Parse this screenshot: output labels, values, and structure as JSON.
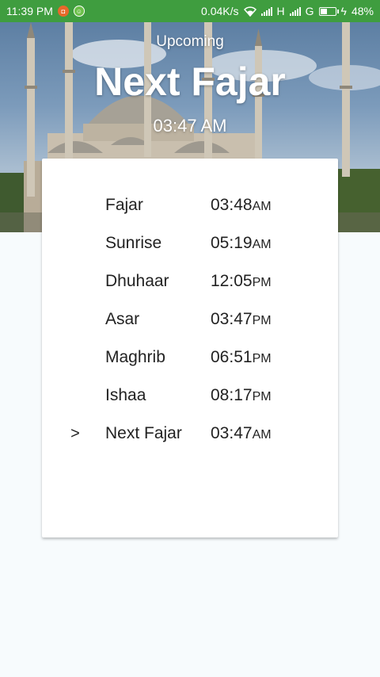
{
  "status_bar": {
    "time": "11:39 PM",
    "net_speed": "0.04K/s",
    "network_type_1": "H",
    "network_type_2": "G",
    "battery_percent": "48%",
    "battery_level": 0.48,
    "color": "#3f9d3f"
  },
  "hero": {
    "subtitle": "Upcoming",
    "title": "Next Fajar",
    "time": "03:47 AM"
  },
  "prayers": [
    {
      "marker": "",
      "name": "Fajar",
      "time": "03:48",
      "ampm": "AM"
    },
    {
      "marker": "",
      "name": "Sunrise",
      "time": "05:19",
      "ampm": "AM"
    },
    {
      "marker": "",
      "name": "Dhuhaar",
      "time": "12:05",
      "ampm": "PM"
    },
    {
      "marker": "",
      "name": "Asar",
      "time": "03:47",
      "ampm": "PM"
    },
    {
      "marker": "",
      "name": "Maghrib",
      "time": "06:51",
      "ampm": "PM"
    },
    {
      "marker": "",
      "name": "Ishaa",
      "time": "08:17",
      "ampm": "PM"
    },
    {
      "marker": ">",
      "name": "Next Fajar",
      "time": "03:47",
      "ampm": "AM"
    }
  ]
}
